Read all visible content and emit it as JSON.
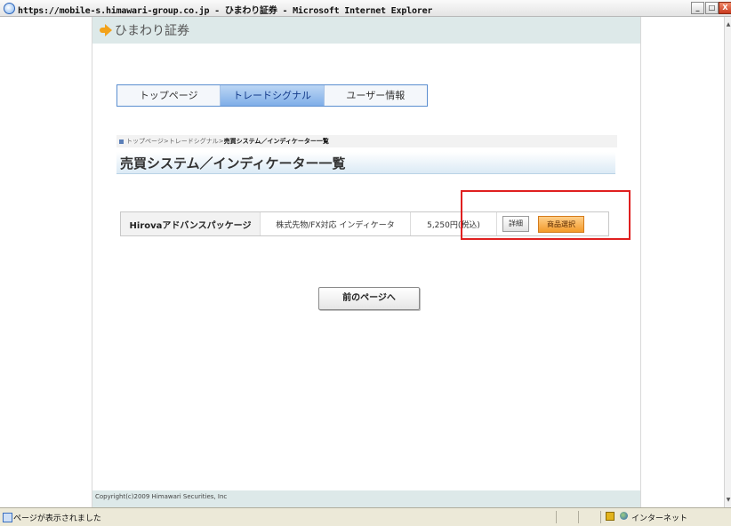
{
  "window": {
    "title": "https://mobile-s.himawari-group.co.jp - ひまわり証券 - Microsoft Internet Explorer",
    "minimize": "_",
    "maximize": "□",
    "close": "X"
  },
  "header": {
    "logo_text": "ひまわり証券"
  },
  "tabs": [
    {
      "label": "トップページ",
      "active": false
    },
    {
      "label": "トレードシグナル",
      "active": true
    },
    {
      "label": "ユーザー情報",
      "active": false
    }
  ],
  "breadcrumb": {
    "items": [
      "トップページ",
      "トレードシグナル"
    ],
    "separator": ">",
    "current": "売買システム／インディケーター一覧"
  },
  "page_title": "売買システム／インディケーター一覧",
  "product": {
    "name": "Hirovaアドバンスパッケージ",
    "category": "株式先物/FX対応 インディケータ",
    "price": "5,250円(税込)",
    "detail_label": "詳細",
    "select_label": "商品選択"
  },
  "back_button": "前のページへ",
  "footer": {
    "copyright": "Copyright(c)2009 Himawari Securities, Inc"
  },
  "status_bar": {
    "status": "ページが表示されました",
    "zone": "インターネット"
  },
  "colors": {
    "highlight": "#e02020",
    "select_button": "#f39a2a",
    "header_band": "#dde9e9"
  }
}
